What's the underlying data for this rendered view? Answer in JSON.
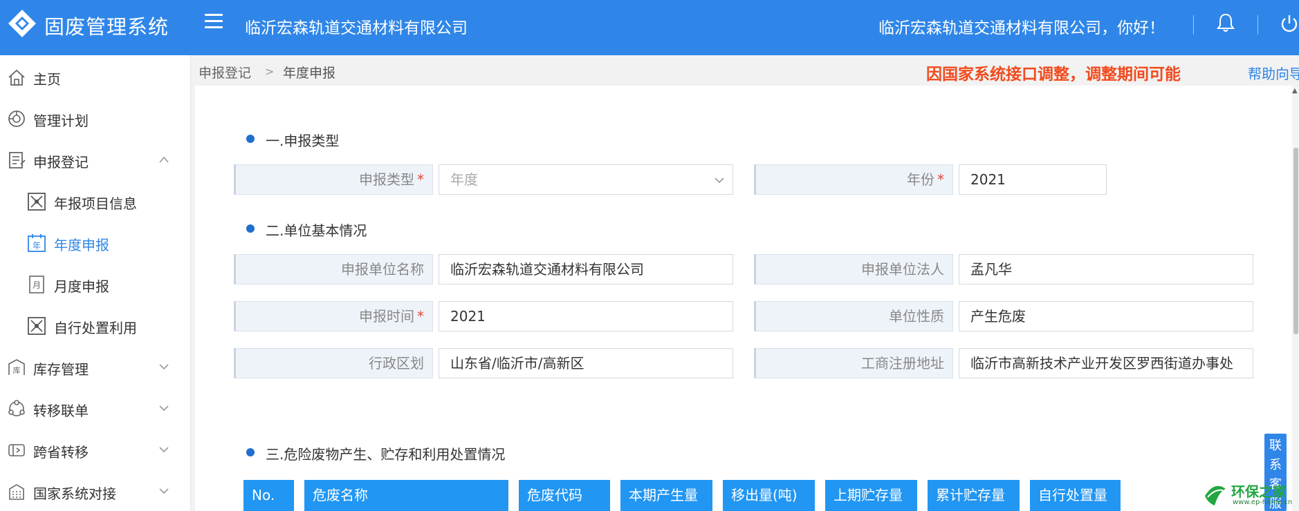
{
  "header": {
    "system_title": "固废管理系统",
    "company": "临沂宏森轨道交通材料有限公司",
    "greeting": "临沂宏森轨道交通材料有限公司，你好！",
    "bg_color": "#2f86e8"
  },
  "sidebar": {
    "items": [
      {
        "label": "主页",
        "icon": "home-icon"
      },
      {
        "label": "管理计划",
        "icon": "plan-icon"
      },
      {
        "label": "申报登记",
        "icon": "declare-icon",
        "expanded": true
      },
      {
        "label": "年报项目信息",
        "icon": "project-icon"
      },
      {
        "label": "年度申报",
        "icon": "year-calendar-icon",
        "active": true,
        "icon_char": "年"
      },
      {
        "label": "月度申报",
        "icon": "month-calendar-icon",
        "icon_char": "月"
      },
      {
        "label": "自行处置利用",
        "icon": "dispose-icon"
      },
      {
        "label": "库存管理",
        "icon": "warehouse-icon",
        "icon_char": "库"
      },
      {
        "label": "转移联单",
        "icon": "transfer-icon"
      },
      {
        "label": "跨省转移",
        "icon": "cross-province-icon"
      },
      {
        "label": "国家系统对接",
        "icon": "national-system-icon"
      }
    ]
  },
  "breadcrumb": {
    "parent": "申报登记",
    "current": "年度申报",
    "notice": "因国家系统接口调整，调整期间可能",
    "help": "帮助向导"
  },
  "sections": {
    "s1": "一.申报类型",
    "s2": "二.单位基本情况",
    "s3": "三.危险废物产生、贮存和利用处置情况"
  },
  "form": {
    "report_type_label": "申报类型",
    "report_type_value": "年度",
    "year_label": "年份",
    "year_value": "2021",
    "unit_name_label": "申报单位名称",
    "unit_name_value": "临沂宏森轨道交通材料有限公司",
    "legal_person_label": "申报单位法人",
    "legal_person_value": "孟凡华",
    "report_time_label": "申报时间",
    "report_time_value": "2021",
    "unit_nature_label": "单位性质",
    "unit_nature_value": "产生危废",
    "region_label": "行政区划",
    "region_value": "山东省/临沂市/高新区",
    "address_label": "工商注册地址",
    "address_value": "临沂市高新技术产业开发区罗西街道办事处",
    "required_mark": "*"
  },
  "table": {
    "headers": [
      "No.",
      "危废名称",
      "危废代码",
      "本期产生量",
      "移出量(吨)",
      "上期贮存量",
      "累计贮存量",
      "自行处置量"
    ],
    "header_color": "#2196f3"
  },
  "float": {
    "contact_chars": [
      "联",
      "系",
      "客",
      "服"
    ]
  },
  "watermark": {
    "text": "环保之家",
    "url": "www.ep-home.cn"
  }
}
